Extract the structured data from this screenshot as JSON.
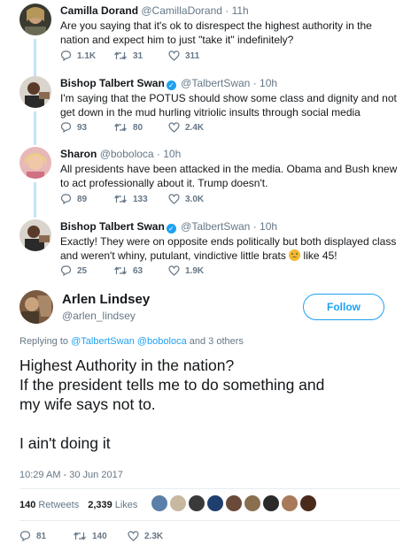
{
  "replies": [
    {
      "name": "Camilla Dorand",
      "handle": "@CamillaDorand",
      "time": "· 11h",
      "verified": false,
      "text": "Are you saying that it's ok to disrespect the highest authority in the nation and expect him to just \"take it\" indefinitely?",
      "reply_count": "1.1K",
      "retweet_count": "31",
      "like_count": "311"
    },
    {
      "name": "Bishop Talbert Swan",
      "handle": "@TalbertSwan",
      "time": "· 10h",
      "verified": true,
      "text": "I'm saying that the POTUS should show some class and dignity and not get down in the mud hurling vitriolic insults through social media",
      "reply_count": "93",
      "retweet_count": "80",
      "like_count": "2.4K"
    },
    {
      "name": "Sharon",
      "handle": "@boboloca",
      "time": "· 10h",
      "verified": false,
      "text": "All presidents have been attacked in the media. Obama and Bush knew to act professionally about it. Trump doesn't.",
      "reply_count": "89",
      "retweet_count": "133",
      "like_count": "3.0K"
    },
    {
      "name": "Bishop Talbert Swan",
      "handle": "@TalbertSwan",
      "time": "· 10h",
      "verified": true,
      "text_before_emoji": "Exactly! They were on opposite ends politically but both displayed class and weren't whiny, putulant, vindictive little brats",
      "text_after_emoji": " like 45!",
      "reply_count": "25",
      "retweet_count": "63",
      "like_count": "1.9K"
    }
  ],
  "main": {
    "name": "Arlen Lindsey",
    "handle": "@arlen_lindsey",
    "follow_label": "Follow",
    "replying_prefix": "Replying to",
    "replying_user1": "@TalbertSwan",
    "replying_user2": "@boboloca",
    "replying_suffix": "and 3 others",
    "text_lines": [
      "Highest Authority in the nation?",
      "If the president tells me to do something and",
      "my wife says not to.",
      "",
      "I ain't doing it"
    ],
    "timestamp": "10:29 AM - 30 Jun 2017",
    "retweets_count": "140",
    "retweets_label": "Retweets",
    "likes_count": "2,339",
    "likes_label": "Likes",
    "reply_count": "81",
    "retweet_count": "140",
    "like_count": "2.3K"
  },
  "colors": {
    "accent": "#1da1f2",
    "thread_line": "#c4e4f7",
    "muted": "#657786"
  },
  "icons": [
    "reply-icon",
    "retweet-icon",
    "like-icon",
    "verified-badge-icon",
    "emoji-angry-icon"
  ]
}
